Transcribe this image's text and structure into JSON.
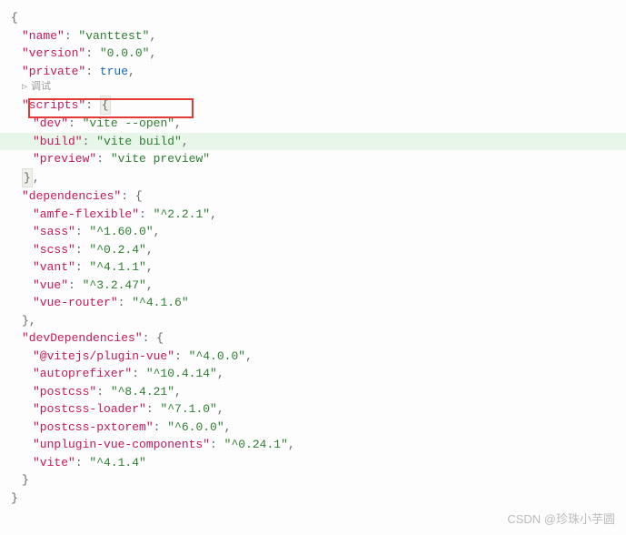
{
  "codelens": "调试",
  "pkg": {
    "name_key": "\"name\"",
    "name_val": "\"vanttest\"",
    "version_key": "\"version\"",
    "version_val": "\"0.0.0\"",
    "private_key": "\"private\"",
    "private_val": "true",
    "scripts_key": "\"scripts\"",
    "scripts": {
      "dev_key": "\"dev\"",
      "dev_val": "\"vite --open\"",
      "build_key": "\"build\"",
      "build_val": "\"vite build\"",
      "preview_key": "\"preview\"",
      "preview_val": "\"vite preview\""
    },
    "deps_key": "\"dependencies\"",
    "deps": {
      "amfe_key": "\"amfe-flexible\"",
      "amfe_val": "\"^2.2.1\"",
      "sass_key": "\"sass\"",
      "sass_val": "\"^1.60.0\"",
      "scss_key": "\"scss\"",
      "scss_val": "\"^0.2.4\"",
      "vant_key": "\"vant\"",
      "vant_val": "\"^4.1.1\"",
      "vue_key": "\"vue\"",
      "vue_val": "\"^3.2.47\"",
      "vuerouter_key": "\"vue-router\"",
      "vuerouter_val": "\"^4.1.6\""
    },
    "devdeps_key": "\"devDependencies\"",
    "devdeps": {
      "pluginvue_key": "\"@vitejs/plugin-vue\"",
      "pluginvue_val": "\"^4.0.0\"",
      "autoprefixer_key": "\"autoprefixer\"",
      "autoprefixer_val": "\"^10.4.14\"",
      "postcss_key": "\"postcss\"",
      "postcss_val": "\"^8.4.21\"",
      "postcssloader_key": "\"postcss-loader\"",
      "postcssloader_val": "\"^7.1.0\"",
      "pxtorem_key": "\"postcss-pxtorem\"",
      "pxtorem_val": "\"^6.0.0\"",
      "unplugin_key": "\"unplugin-vue-components\"",
      "unplugin_val": "\"^0.24.1\"",
      "vite_key": "\"vite\"",
      "vite_val": "\"^4.1.4\""
    }
  },
  "watermark": "CSDN @珍珠小芋圆"
}
